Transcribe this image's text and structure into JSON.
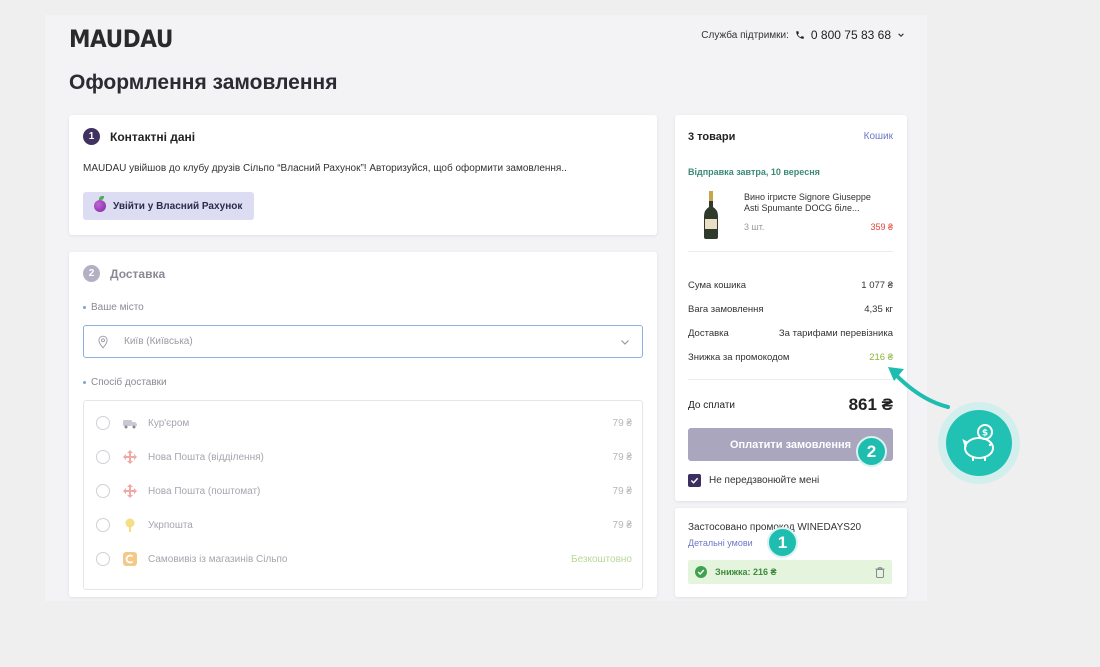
{
  "brand": {
    "logo": "MAUDAU"
  },
  "header": {
    "support_label": "Служба підтримки:",
    "phone": "0 800 75 83 68"
  },
  "page_title": "Оформлення замовлення",
  "contact": {
    "step": "1",
    "title": "Контактні дані",
    "text": "MAUDAU увійшов до клубу друзів Сільпо “Власний Рахунок”! Авторизуйся, щоб оформити замовлення..",
    "login_button": "Увійти у Власний Рахунок"
  },
  "delivery": {
    "step": "2",
    "title": "Доставка",
    "city_label": "Ваше місто",
    "city_value": "Київ (Київська)",
    "method_label": "Спосіб доставки",
    "methods": [
      {
        "name": "Кур'єром",
        "price": "79 ₴",
        "icon": "courier-icon"
      },
      {
        "name": "Нова Пошта (відділення)",
        "price": "79 ₴",
        "icon": "nova-poshta-icon"
      },
      {
        "name": "Нова Пошта (поштомат)",
        "price": "79 ₴",
        "icon": "nova-poshta-icon"
      },
      {
        "name": "Укрпошта",
        "price": "79 ₴",
        "icon": "ukrposhta-icon"
      },
      {
        "name": "Самовивіз із магазинів Сільпо",
        "price": "Безкоштовно",
        "icon": "silpo-icon"
      }
    ]
  },
  "summary": {
    "items_count": "3 товари",
    "cart_link": "Кошик",
    "shipping_date": "Відправка завтра, 10 вересня",
    "product": {
      "name": "Вино ігристе Signore Giuseppe Asti Spumante DOCG біле...",
      "qty": "3 шт.",
      "price": "359 ₴"
    },
    "rows": [
      {
        "label": "Сума кошика",
        "value": "1 077 ₴"
      },
      {
        "label": "Вага замовлення",
        "value": "4,35 кг"
      },
      {
        "label": "Доставка",
        "value": "За тарифами перевізника"
      },
      {
        "label": "Знижка за промокодом",
        "value": "216 ₴"
      }
    ],
    "total_label": "До сплати",
    "total_value": "861 ₴",
    "pay_button": "Оплатити замовлення",
    "no_call_label": "Не передзвонюйте мені"
  },
  "promo": {
    "applied_text": "Застосовано промокод WINEDAYS20",
    "details_link": "Детальні умови",
    "discount_badge": "Знижка: 216 ₴"
  },
  "annotations": {
    "marker_1": "1",
    "marker_2": "2"
  },
  "colors": {
    "accent": "#1fbdb0",
    "primary_dark": "#3f3260",
    "discount_green": "#8ab63a",
    "price_red": "#e4463b"
  }
}
